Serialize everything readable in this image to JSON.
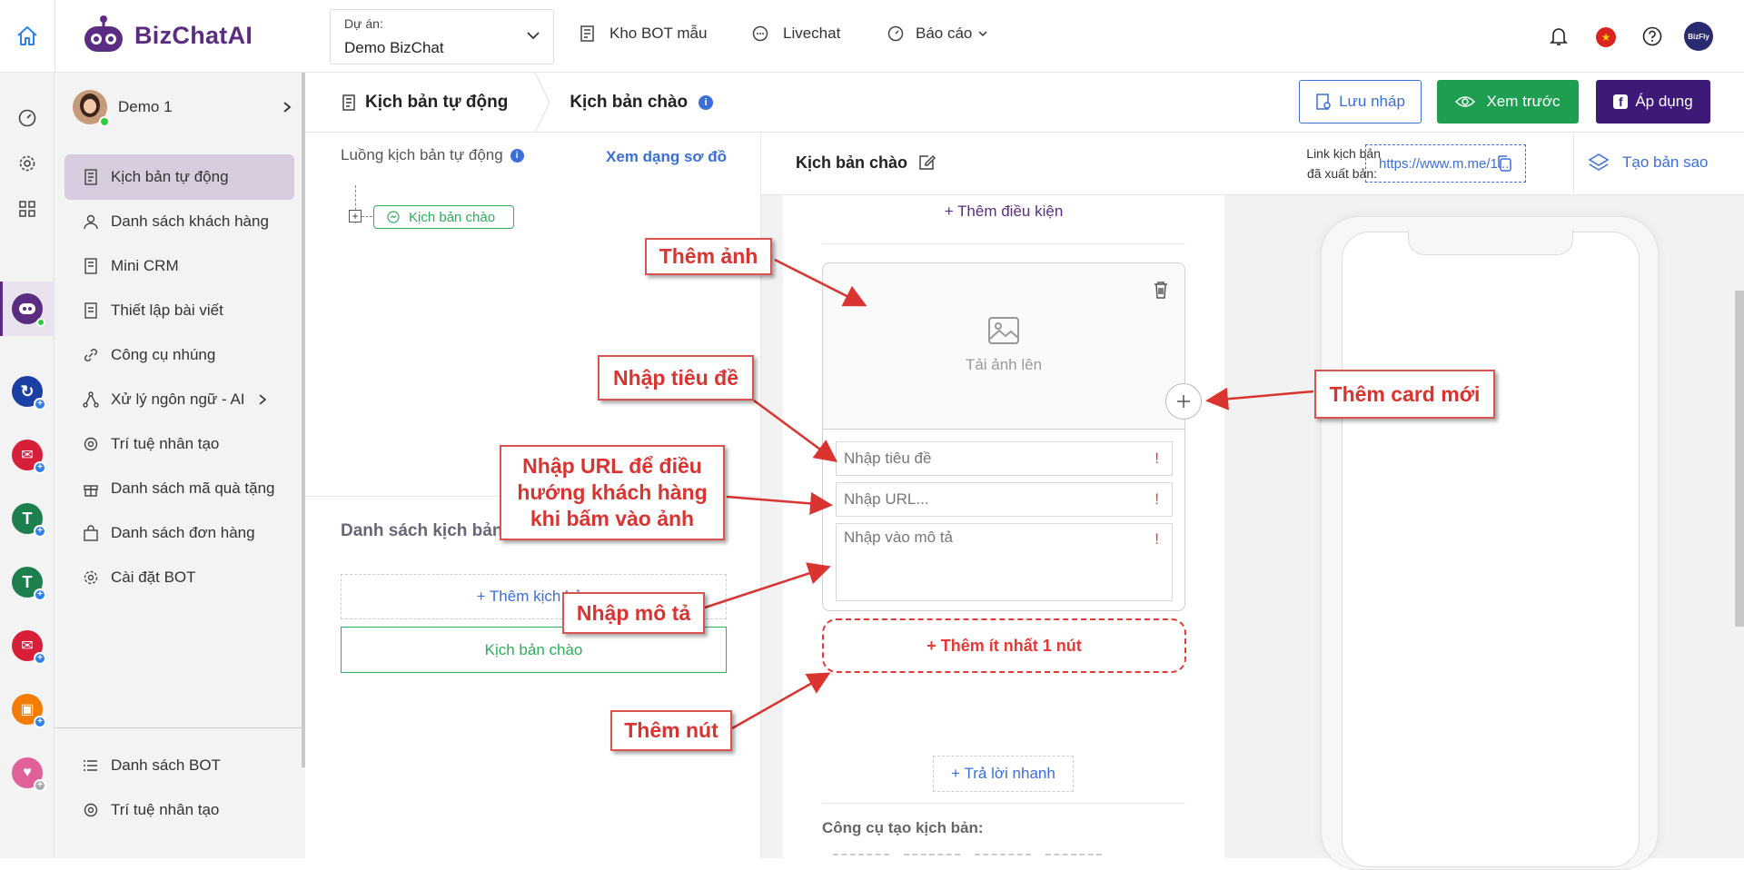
{
  "topbar": {
    "logo_text": "BizChatAI",
    "project_label": "Dự án:",
    "project_value": "Demo BizChat",
    "nav": [
      {
        "label": "Kho BOT mẫu",
        "icon": "template-icon"
      },
      {
        "label": "Livechat",
        "icon": "chat-bubble-icon"
      },
      {
        "label": "Báo cáo",
        "icon": "gauge-icon"
      }
    ],
    "avatar_text": "BizFly"
  },
  "sidebar": {
    "user_name": "Demo 1",
    "items": [
      {
        "label": "Kịch bản tự động",
        "icon": "script-icon",
        "active": true
      },
      {
        "label": "Danh sách khách hàng",
        "icon": "user-icon"
      },
      {
        "label": "Mini CRM",
        "icon": "crm-icon"
      },
      {
        "label": "Thiết lập bài viết",
        "icon": "post-icon"
      },
      {
        "label": "Công cụ nhúng",
        "icon": "link-icon"
      },
      {
        "label": "Xử lý ngôn ngữ - AI",
        "icon": "nlp-icon",
        "has_arrow": true
      },
      {
        "label": "Trí tuệ nhân tạo",
        "icon": "ai-icon"
      },
      {
        "label": "Danh sách mã quà tặng",
        "icon": "gift-icon"
      },
      {
        "label": "Danh sách đơn hàng",
        "icon": "bag-icon"
      },
      {
        "label": "Cài đặt BOT",
        "icon": "gear-icon"
      }
    ],
    "bottom_items": [
      {
        "label": "Danh sách BOT",
        "icon": "list-icon"
      },
      {
        "label": "Trí tuệ nhân tạo",
        "icon": "ai-icon"
      }
    ]
  },
  "header2": {
    "breadcrumb_root": "Kịch bản tự động",
    "breadcrumb_current": "Kịch bản chào",
    "buttons": {
      "draft": "Lưu nháp",
      "preview": "Xem trước",
      "apply": "Áp dụng"
    }
  },
  "flow_panel": {
    "title": "Luồng kịch bản tự động",
    "view_diagram": "Xem dạng sơ đồ",
    "node_label": "Kịch bản chào",
    "list_title": "Danh sách kịch bản",
    "add_script": "+ Thêm kịch bản",
    "script_item": "Kịch bản chào"
  },
  "editor": {
    "title": "Kịch bản chào",
    "link_label_1": "Link kịch bản",
    "link_label_2": "đã xuất bản:",
    "link_value": "https://www.m.me/1...",
    "clone_label": "Tạo bản sao",
    "add_condition": "+ Thêm điều kiện",
    "upload_label": "Tải ảnh lên",
    "title_placeholder": "Nhập tiêu đề",
    "url_placeholder": "Nhập URL...",
    "desc_placeholder": "Nhập vào mô tả",
    "required_mark": "!",
    "add_button": "+ Thêm ít nhất 1 nút",
    "quick_reply": "+ Trả lời nhanh",
    "tools_title": "Công cụ tạo kịch bản:"
  },
  "annotations": {
    "add_image": "Thêm ảnh",
    "enter_title": "Nhập tiêu đề",
    "enter_url_1": "Nhập URL để điều",
    "enter_url_2": "hướng khách hàng",
    "enter_url_3": "khi bấm vào ảnh",
    "enter_desc": "Nhập mô tả",
    "add_button": "Thêm nút",
    "add_card": "Thêm card mới"
  },
  "colors": {
    "brand_purple": "#5a2d82",
    "apply_bg": "#3d1a78",
    "preview_green": "#1e9e50",
    "link_blue": "#3b6fd8",
    "annotation_red": "#d9342f",
    "active_item_bg": "#d8ccdf",
    "node_green": "#2fae5a"
  }
}
